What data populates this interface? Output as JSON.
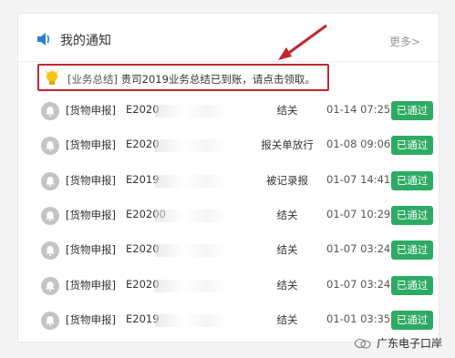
{
  "header": {
    "title": "我的通知",
    "more": "更多>"
  },
  "notice": {
    "tag": "[业务总结]",
    "message": "贵司2019业务总结已到账，请点击领取。"
  },
  "rows": [
    {
      "tag": "[货物申报]",
      "number": "E2020",
      "status": "结关",
      "date": "01-14 07:25",
      "badge": "已通过"
    },
    {
      "tag": "[货物申报]",
      "number": "E2020",
      "status": "报关单放行",
      "date": "01-08 09:06",
      "badge": "已通过"
    },
    {
      "tag": "[货物申报]",
      "number": "E2019",
      "status": "被记录报",
      "date": "01-07 14:41",
      "badge": "已通过"
    },
    {
      "tag": "[货物申报]",
      "number": "E20200",
      "status": "结关",
      "date": "01-07 10:29",
      "badge": "已通过"
    },
    {
      "tag": "[货物申报]",
      "number": "E2020",
      "status": "结关",
      "date": "01-07 03:24",
      "badge": "已通过"
    },
    {
      "tag": "[货物申报]",
      "number": "E2020",
      "status": "结关",
      "date": "01-07 03:24",
      "badge": "已通过"
    },
    {
      "tag": "[货物申报]",
      "number": "E2019",
      "status": "结关",
      "date": "01-01 03:35",
      "badge": "已通过"
    }
  ],
  "watermark": "广东电子口岸",
  "colors": {
    "badge": "#2dab63",
    "highlight": "#c1272d",
    "speaker": "#2a7fd4",
    "bulb": "#f5c518"
  }
}
